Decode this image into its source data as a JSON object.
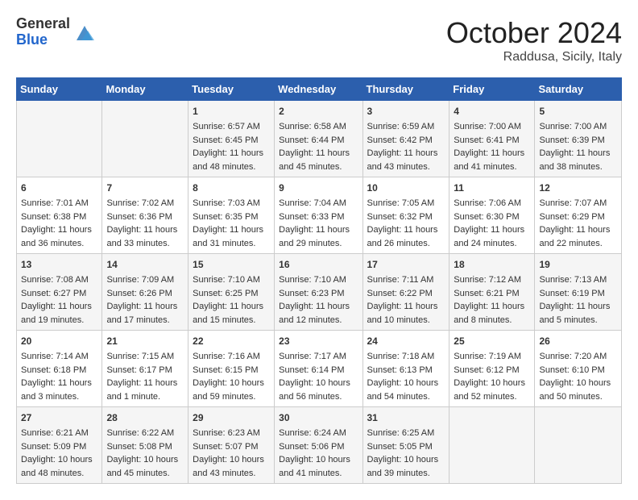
{
  "header": {
    "logo_general": "General",
    "logo_blue": "Blue",
    "month_title": "October 2024",
    "location": "Raddusa, Sicily, Italy"
  },
  "days_of_week": [
    "Sunday",
    "Monday",
    "Tuesday",
    "Wednesday",
    "Thursday",
    "Friday",
    "Saturday"
  ],
  "weeks": [
    [
      {
        "day": "",
        "info": ""
      },
      {
        "day": "",
        "info": ""
      },
      {
        "day": "1",
        "info": "Sunrise: 6:57 AM\nSunset: 6:45 PM\nDaylight: 11 hours and 48 minutes."
      },
      {
        "day": "2",
        "info": "Sunrise: 6:58 AM\nSunset: 6:44 PM\nDaylight: 11 hours and 45 minutes."
      },
      {
        "day": "3",
        "info": "Sunrise: 6:59 AM\nSunset: 6:42 PM\nDaylight: 11 hours and 43 minutes."
      },
      {
        "day": "4",
        "info": "Sunrise: 7:00 AM\nSunset: 6:41 PM\nDaylight: 11 hours and 41 minutes."
      },
      {
        "day": "5",
        "info": "Sunrise: 7:00 AM\nSunset: 6:39 PM\nDaylight: 11 hours and 38 minutes."
      }
    ],
    [
      {
        "day": "6",
        "info": "Sunrise: 7:01 AM\nSunset: 6:38 PM\nDaylight: 11 hours and 36 minutes."
      },
      {
        "day": "7",
        "info": "Sunrise: 7:02 AM\nSunset: 6:36 PM\nDaylight: 11 hours and 33 minutes."
      },
      {
        "day": "8",
        "info": "Sunrise: 7:03 AM\nSunset: 6:35 PM\nDaylight: 11 hours and 31 minutes."
      },
      {
        "day": "9",
        "info": "Sunrise: 7:04 AM\nSunset: 6:33 PM\nDaylight: 11 hours and 29 minutes."
      },
      {
        "day": "10",
        "info": "Sunrise: 7:05 AM\nSunset: 6:32 PM\nDaylight: 11 hours and 26 minutes."
      },
      {
        "day": "11",
        "info": "Sunrise: 7:06 AM\nSunset: 6:30 PM\nDaylight: 11 hours and 24 minutes."
      },
      {
        "day": "12",
        "info": "Sunrise: 7:07 AM\nSunset: 6:29 PM\nDaylight: 11 hours and 22 minutes."
      }
    ],
    [
      {
        "day": "13",
        "info": "Sunrise: 7:08 AM\nSunset: 6:27 PM\nDaylight: 11 hours and 19 minutes."
      },
      {
        "day": "14",
        "info": "Sunrise: 7:09 AM\nSunset: 6:26 PM\nDaylight: 11 hours and 17 minutes."
      },
      {
        "day": "15",
        "info": "Sunrise: 7:10 AM\nSunset: 6:25 PM\nDaylight: 11 hours and 15 minutes."
      },
      {
        "day": "16",
        "info": "Sunrise: 7:10 AM\nSunset: 6:23 PM\nDaylight: 11 hours and 12 minutes."
      },
      {
        "day": "17",
        "info": "Sunrise: 7:11 AM\nSunset: 6:22 PM\nDaylight: 11 hours and 10 minutes."
      },
      {
        "day": "18",
        "info": "Sunrise: 7:12 AM\nSunset: 6:21 PM\nDaylight: 11 hours and 8 minutes."
      },
      {
        "day": "19",
        "info": "Sunrise: 7:13 AM\nSunset: 6:19 PM\nDaylight: 11 hours and 5 minutes."
      }
    ],
    [
      {
        "day": "20",
        "info": "Sunrise: 7:14 AM\nSunset: 6:18 PM\nDaylight: 11 hours and 3 minutes."
      },
      {
        "day": "21",
        "info": "Sunrise: 7:15 AM\nSunset: 6:17 PM\nDaylight: 11 hours and 1 minute."
      },
      {
        "day": "22",
        "info": "Sunrise: 7:16 AM\nSunset: 6:15 PM\nDaylight: 10 hours and 59 minutes."
      },
      {
        "day": "23",
        "info": "Sunrise: 7:17 AM\nSunset: 6:14 PM\nDaylight: 10 hours and 56 minutes."
      },
      {
        "day": "24",
        "info": "Sunrise: 7:18 AM\nSunset: 6:13 PM\nDaylight: 10 hours and 54 minutes."
      },
      {
        "day": "25",
        "info": "Sunrise: 7:19 AM\nSunset: 6:12 PM\nDaylight: 10 hours and 52 minutes."
      },
      {
        "day": "26",
        "info": "Sunrise: 7:20 AM\nSunset: 6:10 PM\nDaylight: 10 hours and 50 minutes."
      }
    ],
    [
      {
        "day": "27",
        "info": "Sunrise: 6:21 AM\nSunset: 5:09 PM\nDaylight: 10 hours and 48 minutes."
      },
      {
        "day": "28",
        "info": "Sunrise: 6:22 AM\nSunset: 5:08 PM\nDaylight: 10 hours and 45 minutes."
      },
      {
        "day": "29",
        "info": "Sunrise: 6:23 AM\nSunset: 5:07 PM\nDaylight: 10 hours and 43 minutes."
      },
      {
        "day": "30",
        "info": "Sunrise: 6:24 AM\nSunset: 5:06 PM\nDaylight: 10 hours and 41 minutes."
      },
      {
        "day": "31",
        "info": "Sunrise: 6:25 AM\nSunset: 5:05 PM\nDaylight: 10 hours and 39 minutes."
      },
      {
        "day": "",
        "info": ""
      },
      {
        "day": "",
        "info": ""
      }
    ]
  ]
}
